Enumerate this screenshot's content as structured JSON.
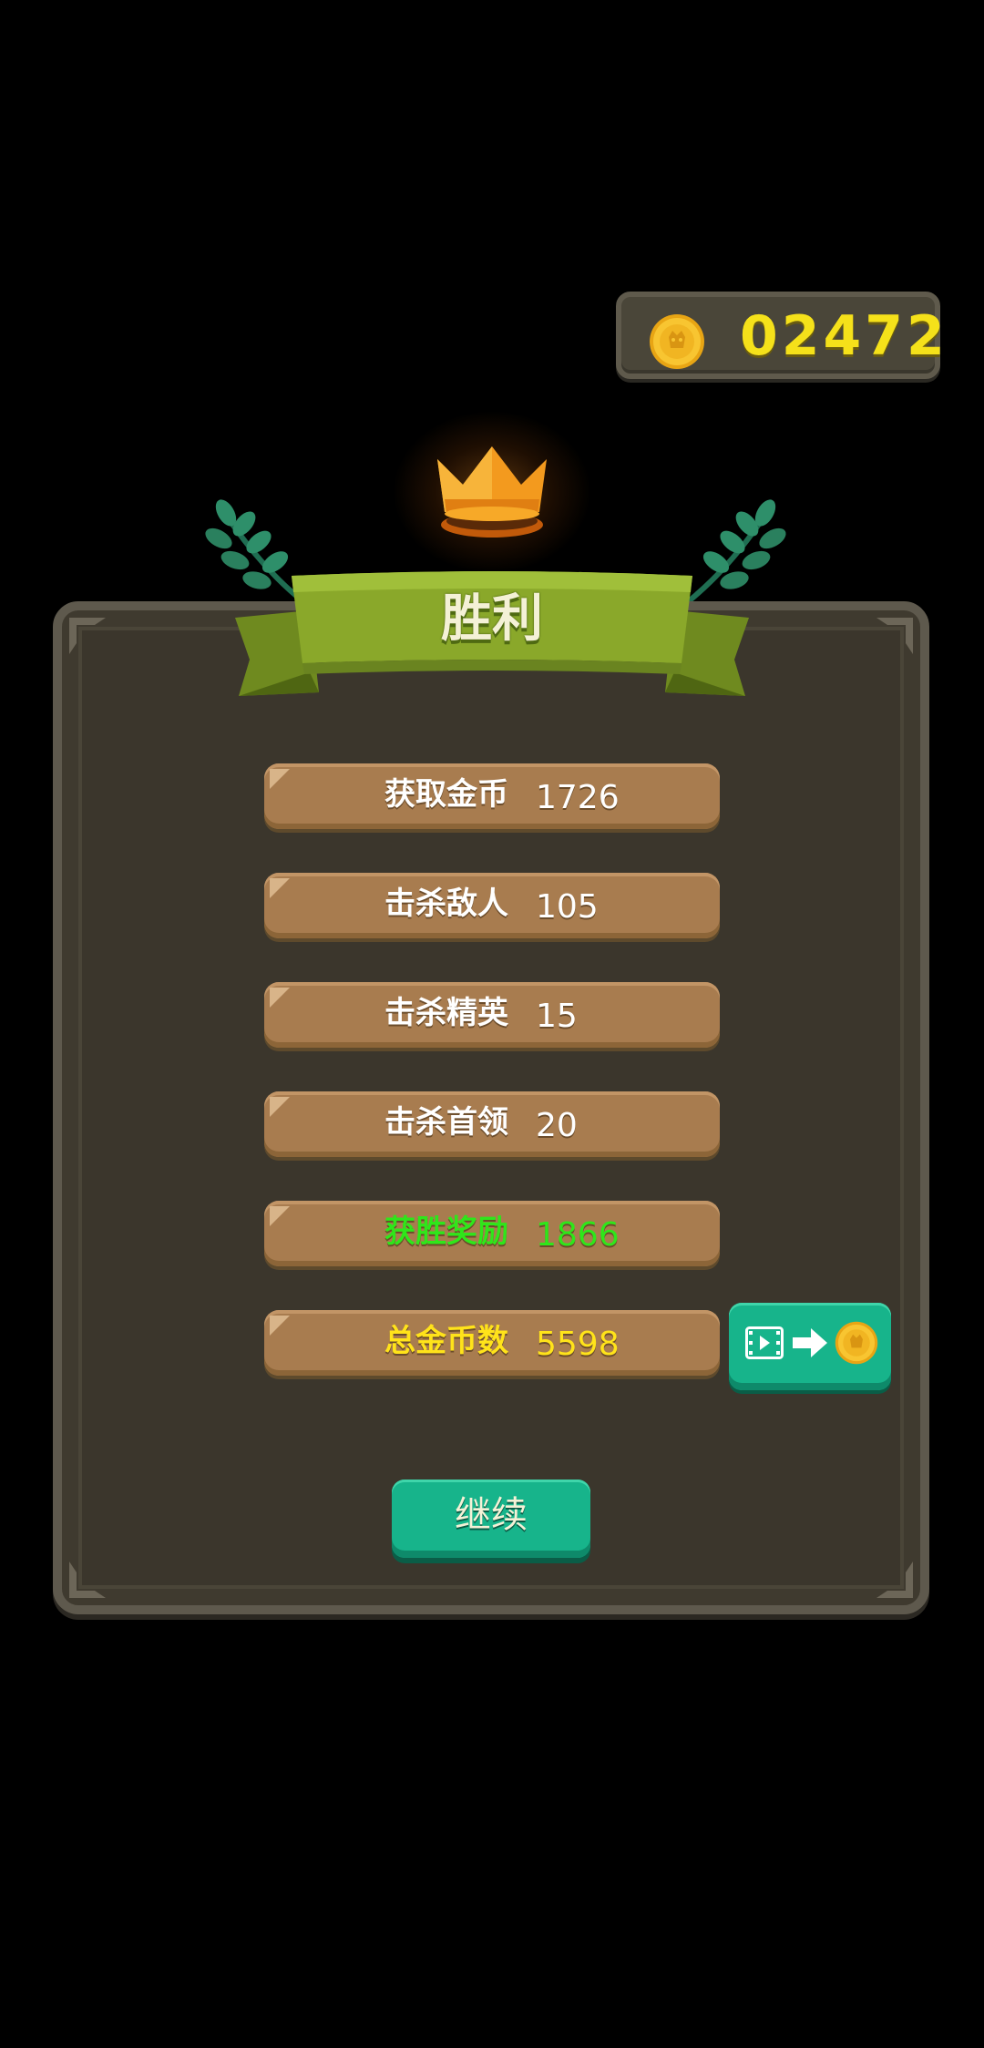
{
  "coin_counter": {
    "amount": "02472",
    "icon": "gold-coin-icon"
  },
  "banner": {
    "title": "胜利"
  },
  "stats": [
    {
      "label": "获取金币",
      "value": "1726",
      "color": "#ffffff"
    },
    {
      "label": "击杀敌人",
      "value": "105",
      "color": "#ffffff"
    },
    {
      "label": "击杀精英",
      "value": "15",
      "color": "#ffffff"
    },
    {
      "label": "击杀首领",
      "value": "20",
      "color": "#ffffff"
    },
    {
      "label": "获胜奖励",
      "value": "1866",
      "color": "#2fe61a"
    },
    {
      "label": "总金币数",
      "value": "5598",
      "color": "#ffe31a"
    }
  ],
  "buttons": {
    "continue_label": "继续",
    "video_reward_icons": [
      "video-icon",
      "arrow-right-icon",
      "gold-coin-icon"
    ]
  },
  "colors": {
    "accent_green": "#17b48b",
    "banner_green": "#8aa82a",
    "panel": "#3b362c",
    "row": "#a87c4f",
    "coin_text": "#f5e11a"
  }
}
